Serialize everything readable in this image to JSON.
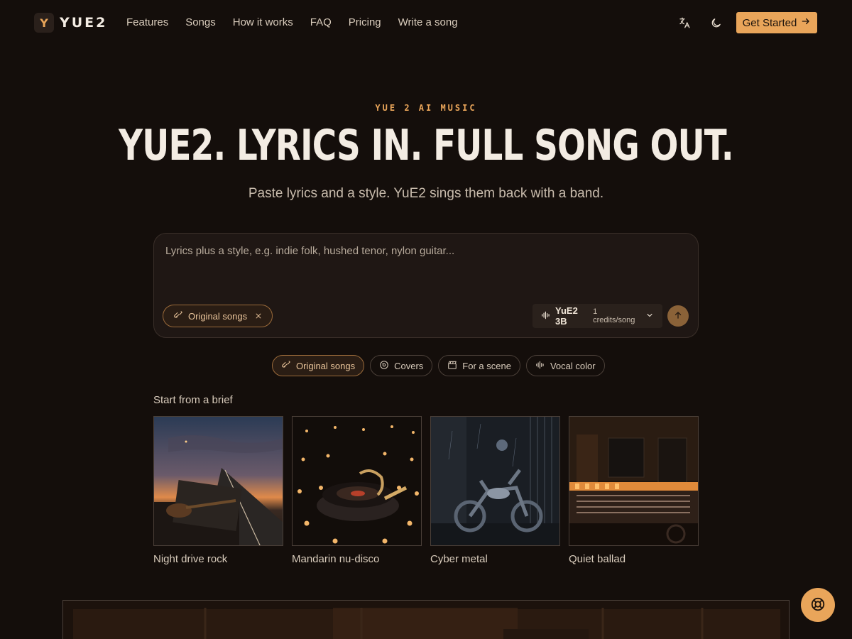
{
  "brand": {
    "logo_letter": "Y",
    "name": "YUE2"
  },
  "nav": {
    "links": [
      "Features",
      "Songs",
      "How it works",
      "FAQ",
      "Pricing",
      "Write a song"
    ],
    "cta_label": "Get Started"
  },
  "icons": {
    "translate": "translate-icon",
    "theme": "moon-icon",
    "arrow": "arrow-right-icon",
    "help": "lifebuoy-icon"
  },
  "hero": {
    "eyebrow": "YUE 2 AI MUSIC",
    "headline": "YUE2. LYRICS IN. FULL SONG OUT.",
    "subline": "Paste lyrics and a style. YuE2 sings them back with a band."
  },
  "prompt": {
    "placeholder": "Lyrics plus a style, e.g. indie folk, hushed tenor, nylon guitar...",
    "tag": "Original songs",
    "model": "YuE2 3B",
    "model_cost": "1 credits/song"
  },
  "categories": [
    {
      "label": "Original songs",
      "icon": "guitar-icon",
      "active": true
    },
    {
      "label": "Covers",
      "icon": "vinyl-icon",
      "active": false
    },
    {
      "label": "For a scene",
      "icon": "clapper-icon",
      "active": false
    },
    {
      "label": "Vocal color",
      "icon": "waveform-icon",
      "active": false
    }
  ],
  "briefs": {
    "title": "Start from a brief",
    "items": [
      {
        "label": "Night drive rock"
      },
      {
        "label": "Mandarin nu-disco"
      },
      {
        "label": "Cyber metal"
      },
      {
        "label": "Quiet ballad"
      }
    ]
  },
  "colors": {
    "accent": "#e9a55a",
    "background": "#140e0b",
    "text": "#f1e6d8"
  }
}
